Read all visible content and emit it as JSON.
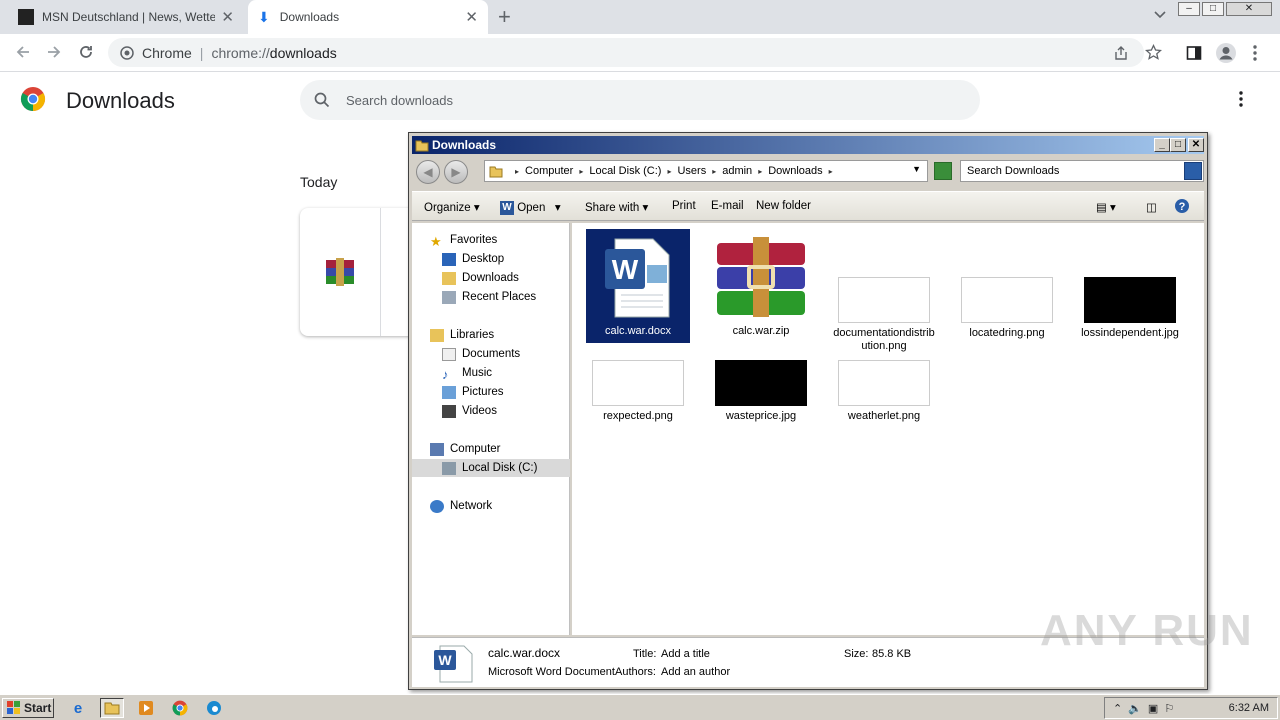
{
  "browser": {
    "tabs": [
      {
        "label": "MSN Deutschland | News, Wetter, Sp"
      },
      {
        "label": "Downloads"
      }
    ],
    "omnibox": {
      "site_label": "Chrome",
      "url_scheme": "chrome://",
      "url_path": "downloads"
    }
  },
  "downloads_page": {
    "title": "Downloads",
    "search_placeholder": "Search downloads",
    "section": "Today"
  },
  "explorer": {
    "title": "Downloads",
    "breadcrumb": [
      "Computer",
      "Local Disk (C:)",
      "Users",
      "admin",
      "Downloads"
    ],
    "search_placeholder": "Search Downloads",
    "commands": [
      "Organize",
      "Open",
      "Share with",
      "Print",
      "E-mail",
      "New folder"
    ],
    "nav": {
      "favorites": "Favorites",
      "desktop": "Desktop",
      "downloads": "Downloads",
      "recent": "Recent Places",
      "libraries": "Libraries",
      "documents": "Documents",
      "music": "Music",
      "pictures": "Pictures",
      "videos": "Videos",
      "computer": "Computer",
      "localdisk": "Local Disk (C:)",
      "network": "Network"
    },
    "files": [
      {
        "name": "calc.war.docx"
      },
      {
        "name": "calc.war.zip"
      },
      {
        "name": "documentationdistribution.png"
      },
      {
        "name": "locatedring.png"
      },
      {
        "name": "lossindependent.jpg"
      },
      {
        "name": "rexpected.png"
      },
      {
        "name": "wasteprice.jpg"
      },
      {
        "name": "weatherlet.png"
      }
    ],
    "details": {
      "filename": "calc.war.docx",
      "type": "Microsoft Word Document",
      "title_label": "Title:",
      "title_value": "Add a title",
      "authors_label": "Authors:",
      "authors_value": "Add an author",
      "size_label": "Size:",
      "size_value": "85.8 KB"
    }
  },
  "watermark": "ANY RUN",
  "taskbar": {
    "start_label": "Start",
    "clock": "6:32 AM"
  },
  "colors": {
    "selection": "#0a246a",
    "titlebar": "#0a246a",
    "chrome_tabstrip": "#dee1e6"
  }
}
